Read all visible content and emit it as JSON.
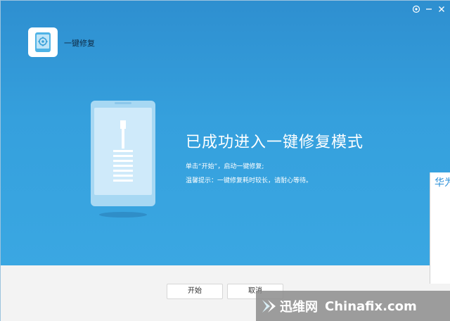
{
  "app": {
    "title": "一键修复",
    "icon": "phone-gear-icon"
  },
  "window_controls": {
    "icons": [
      "settings-circle-icon",
      "minimize-icon",
      "close-icon"
    ]
  },
  "main": {
    "headline": "已成功进入一键修复模式",
    "instruction": "单击“开始”，启动一键修复;",
    "tip": "温馨提示：一键修复耗时较长，请耐心等待。"
  },
  "side_tab": {
    "text": "华为"
  },
  "buttons": {
    "start": "开始",
    "cancel": "取消"
  },
  "watermark": {
    "cn": "迅维网",
    "en": "Chinafix.com"
  },
  "colors": {
    "panel_blue": "#35a0dd",
    "footer_gray": "#f3f3f3",
    "accent_blue": "#2a8fd8"
  }
}
